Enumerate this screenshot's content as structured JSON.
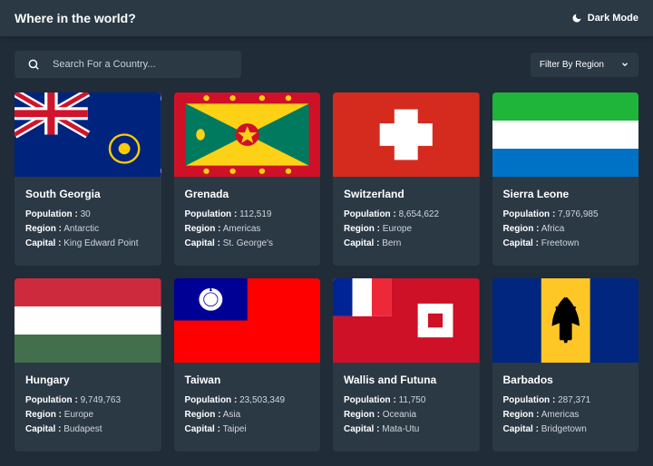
{
  "header": {
    "title": "Where in the world?",
    "darkmode": "Dark Mode"
  },
  "search": {
    "placeholder": "Search For a Country..."
  },
  "filter": {
    "label": "Filter By Region"
  },
  "labels": {
    "population": "Population :",
    "region": "Region :",
    "capital": "Capital :"
  },
  "countries": [
    {
      "name": "South Georgia",
      "population": "30",
      "region": "Antarctic",
      "capital": "King Edward Point",
      "flag": "sg"
    },
    {
      "name": "Grenada",
      "population": "112,519",
      "region": "Americas",
      "capital": "St. George's",
      "flag": "gd"
    },
    {
      "name": "Switzerland",
      "population": "8,654,622",
      "region": "Europe",
      "capital": "Bern",
      "flag": "ch"
    },
    {
      "name": "Sierra Leone",
      "population": "7,976,985",
      "region": "Africa",
      "capital": "Freetown",
      "flag": "sl"
    },
    {
      "name": "Hungary",
      "population": "9,749,763",
      "region": "Europe",
      "capital": "Budapest",
      "flag": "hu"
    },
    {
      "name": "Taiwan",
      "population": "23,503,349",
      "region": "Asia",
      "capital": "Taipei",
      "flag": "tw"
    },
    {
      "name": "Wallis and Futuna",
      "population": "11,750",
      "region": "Oceania",
      "capital": "Mata-Utu",
      "flag": "wf"
    },
    {
      "name": "Barbados",
      "population": "287,371",
      "region": "Americas",
      "capital": "Bridgetown",
      "flag": "bb"
    }
  ]
}
